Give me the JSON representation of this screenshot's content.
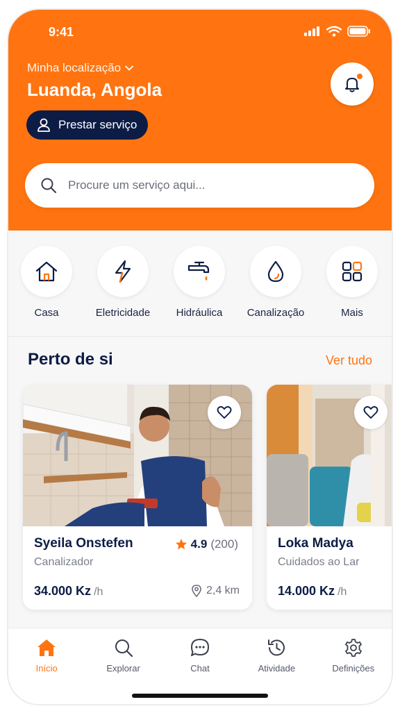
{
  "status_bar": {
    "time": "9:41"
  },
  "header": {
    "location_label": "Minha localização",
    "location_value": "Luanda, Angola",
    "provide_service_label": "Prestar serviço"
  },
  "search": {
    "placeholder": "Procure um serviço aqui..."
  },
  "categories": [
    {
      "label": "Casa",
      "icon": "house-icon"
    },
    {
      "label": "Eletricidade",
      "icon": "lightning-icon"
    },
    {
      "label": "Hidráulica",
      "icon": "faucet-icon"
    },
    {
      "label": "Canalização",
      "icon": "water-drop-icon"
    },
    {
      "label": "Mais",
      "icon": "grid-icon"
    }
  ],
  "nearby": {
    "title": "Perto de si",
    "see_all": "Ver tudo",
    "providers": [
      {
        "name": "Syeila Onstefen",
        "role": "Canalizador",
        "rating": "4.9",
        "reviews": "(200)",
        "price": "34.000 Kz",
        "unit": "/h",
        "distance": "2,4 km"
      },
      {
        "name": "Loka Madya",
        "role": "Cuidados ao Lar",
        "price": "14.000 Kz",
        "unit": "/h"
      }
    ]
  },
  "bottom_nav": [
    {
      "label": "Início",
      "icon": "home-icon",
      "active": true
    },
    {
      "label": "Explorar",
      "icon": "search-icon"
    },
    {
      "label": "Chat",
      "icon": "chat-icon"
    },
    {
      "label": "Atividade",
      "icon": "history-icon"
    },
    {
      "label": "Definições",
      "icon": "settings-icon"
    }
  ],
  "colors": {
    "brand": "#ff7410",
    "navy": "#0d1c45",
    "background": "#f7f7f8"
  }
}
